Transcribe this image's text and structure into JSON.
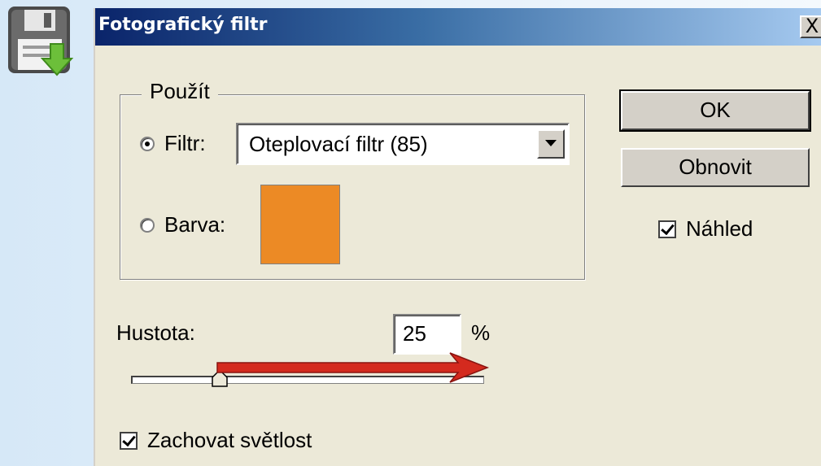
{
  "dialog": {
    "title": "Fotografický filtr",
    "close_label": "X"
  },
  "use_group": {
    "legend": "Použít",
    "filter_label": "Filtr:",
    "filter_selected": true,
    "filter_value": "Oteplovací filtr (85)",
    "color_label": "Barva:",
    "color_selected": false,
    "color_swatch": "#ec8a25"
  },
  "buttons": {
    "ok_label": "OK",
    "reset_label": "Obnovit"
  },
  "preview": {
    "label": "Náhled",
    "checked": true
  },
  "density": {
    "label": "Hustota:",
    "value": "25",
    "unit": "%",
    "slider_fraction": 0.25
  },
  "preserve_luminosity": {
    "label": "Zachovat světlost",
    "checked": true
  },
  "annotation": {
    "arrow_color": "#d42a1e"
  }
}
